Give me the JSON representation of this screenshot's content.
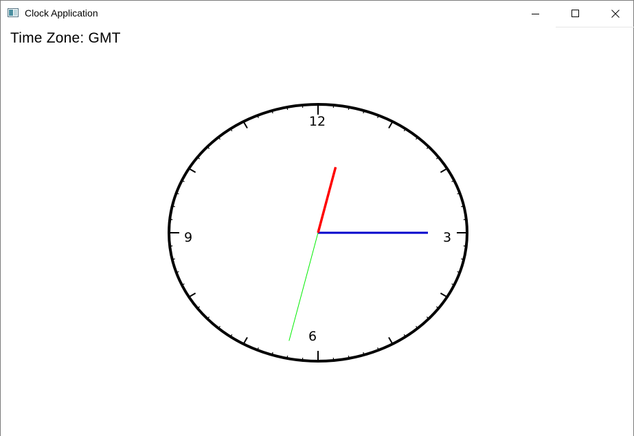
{
  "window": {
    "title": "Clock Application",
    "icon": "app-window-icon",
    "controls": {
      "minimize_icon": "minimize-icon",
      "maximize_icon": "maximize-icon",
      "close_icon": "close-icon"
    }
  },
  "timezone_label": "Time Zone: GMT",
  "clock": {
    "numerals": {
      "twelve": "12",
      "three": "3",
      "six": "6",
      "nine": "9"
    },
    "time": {
      "hour": 0.5,
      "minute": 15,
      "second": 32.5
    },
    "colors": {
      "face": "#ffffff",
      "rim": "#000000",
      "hour_hand": "#ff0000",
      "minute_hand": "#0000cc",
      "second_hand": "#00ee00"
    }
  }
}
